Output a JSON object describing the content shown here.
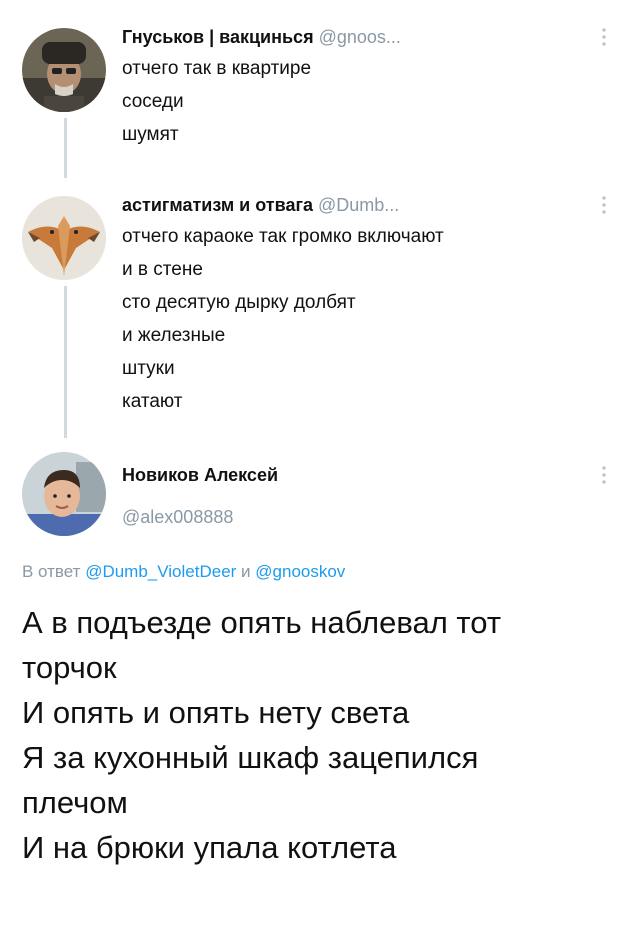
{
  "tweets": [
    {
      "author": "Гнуськов | вакцинься",
      "handle": "@gnoos...",
      "lines": [
        "отчего так в квартире",
        "соседи",
        "шумят"
      ]
    },
    {
      "author": "астигматизм и отвага",
      "handle": "@Dumb...",
      "lines": [
        "отчего караоке так громко включают",
        "и в стене",
        "сто десятую дырку долбят",
        "и железные",
        "штуки",
        "катают"
      ]
    }
  ],
  "reply": {
    "author": "Новиков Алексей",
    "handle": "@alex008888",
    "reply_prefix": "В ответ",
    "reply_user_1": "@Dumb_VioletDeer",
    "reply_conj": "и",
    "reply_user_2": "@gnooskov",
    "lines": [
      "А в подъезде опять наблевал тот",
      "торчок",
      "И опять и опять нету света",
      "Я за кухонный шкаф зацепился",
      "плечом",
      "И на брюки упала котлета"
    ]
  },
  "icons": {
    "more": "vertical-dots-icon"
  },
  "colors": {
    "handle": "#8b98a5",
    "link": "#1d9bf0",
    "thread_line": "#cfd9de"
  }
}
